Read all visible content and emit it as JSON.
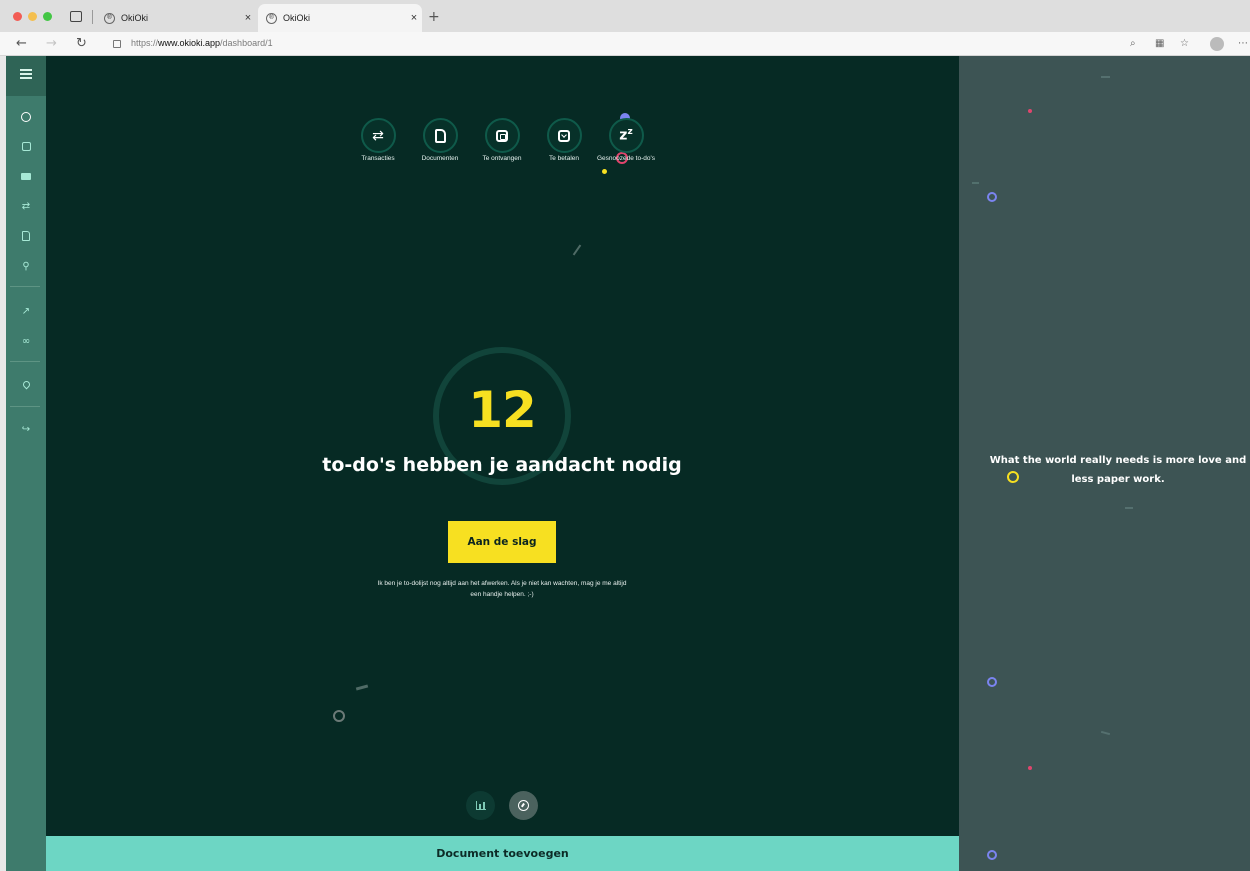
{
  "browser": {
    "tabs": [
      {
        "label": "OkiOki",
        "close": "×"
      },
      {
        "label": "OkiOki",
        "close": "×"
      }
    ],
    "new_tab": "+",
    "favicon": "®",
    "url_prefix": "https://",
    "url_host": "www.okioki.app",
    "url_path": "/dashboard/1",
    "icons": [
      "sidebar-toggle-icon",
      "back-arrow-icon",
      "forward-arrow-icon",
      "reload-icon",
      "lock-icon",
      "search-icon",
      "reader-view-icon",
      "favorites-icon",
      "profile-icon",
      "more-icon"
    ]
  },
  "sidebar": {
    "items": [
      {
        "name": "dashboard",
        "icon": "gauge-icon",
        "active": true
      },
      {
        "name": "todos",
        "icon": "checkbox-icon"
      },
      {
        "name": "payments",
        "icon": "card-icon"
      },
      {
        "name": "transactions",
        "icon": "transfer-arrows-icon"
      },
      {
        "name": "documents",
        "icon": "document-icon"
      },
      {
        "name": "contacts",
        "icon": "user-icon"
      },
      {
        "name": "add-user",
        "icon": "add-user-icon"
      },
      {
        "name": "integrations",
        "icon": "link-icon"
      },
      {
        "name": "location",
        "icon": "pin-icon"
      },
      {
        "name": "logout",
        "icon": "logout-icon"
      }
    ]
  },
  "shortcuts": [
    {
      "label": "Transacties",
      "icon": "transfer-arrows-icon"
    },
    {
      "label": "Documenten",
      "icon": "document-icon"
    },
    {
      "label": "Te ontvangen",
      "icon": "receive-document-icon"
    },
    {
      "label": "Te betalen",
      "icon": "pay-document-icon"
    },
    {
      "label": "Gesnoozede to-do's",
      "icon": "snooze-icon",
      "glyph": "z",
      "glyph_sup": "z"
    }
  ],
  "todo": {
    "count": "12",
    "headline": "to-do's hebben je aandacht nodig",
    "cta": "Aan de slag",
    "help_line1": "Ik ben je to-dolijst nog altijd aan het afwerken. Als je niet kan wachten, mag je me altijd",
    "help_line2": "een handje helpen. ;-)"
  },
  "view_toggles": [
    {
      "name": "chart-view",
      "icon": "bar-chart-icon",
      "active": false
    },
    {
      "name": "gauge-view",
      "icon": "gauge-icon",
      "active": true
    }
  ],
  "add_document": "Document toevoegen",
  "quote": "What the world really needs is more love and less paper work.",
  "colors": {
    "main_bg": "#062a24",
    "accent_yellow": "#f7e021",
    "accent_teal": "#6dd6c4",
    "sidebar": "#3e7b6c",
    "right_panel": "#3d5454",
    "confetti_purple": "#7b84f0",
    "confetti_pink": "#e0456d"
  }
}
